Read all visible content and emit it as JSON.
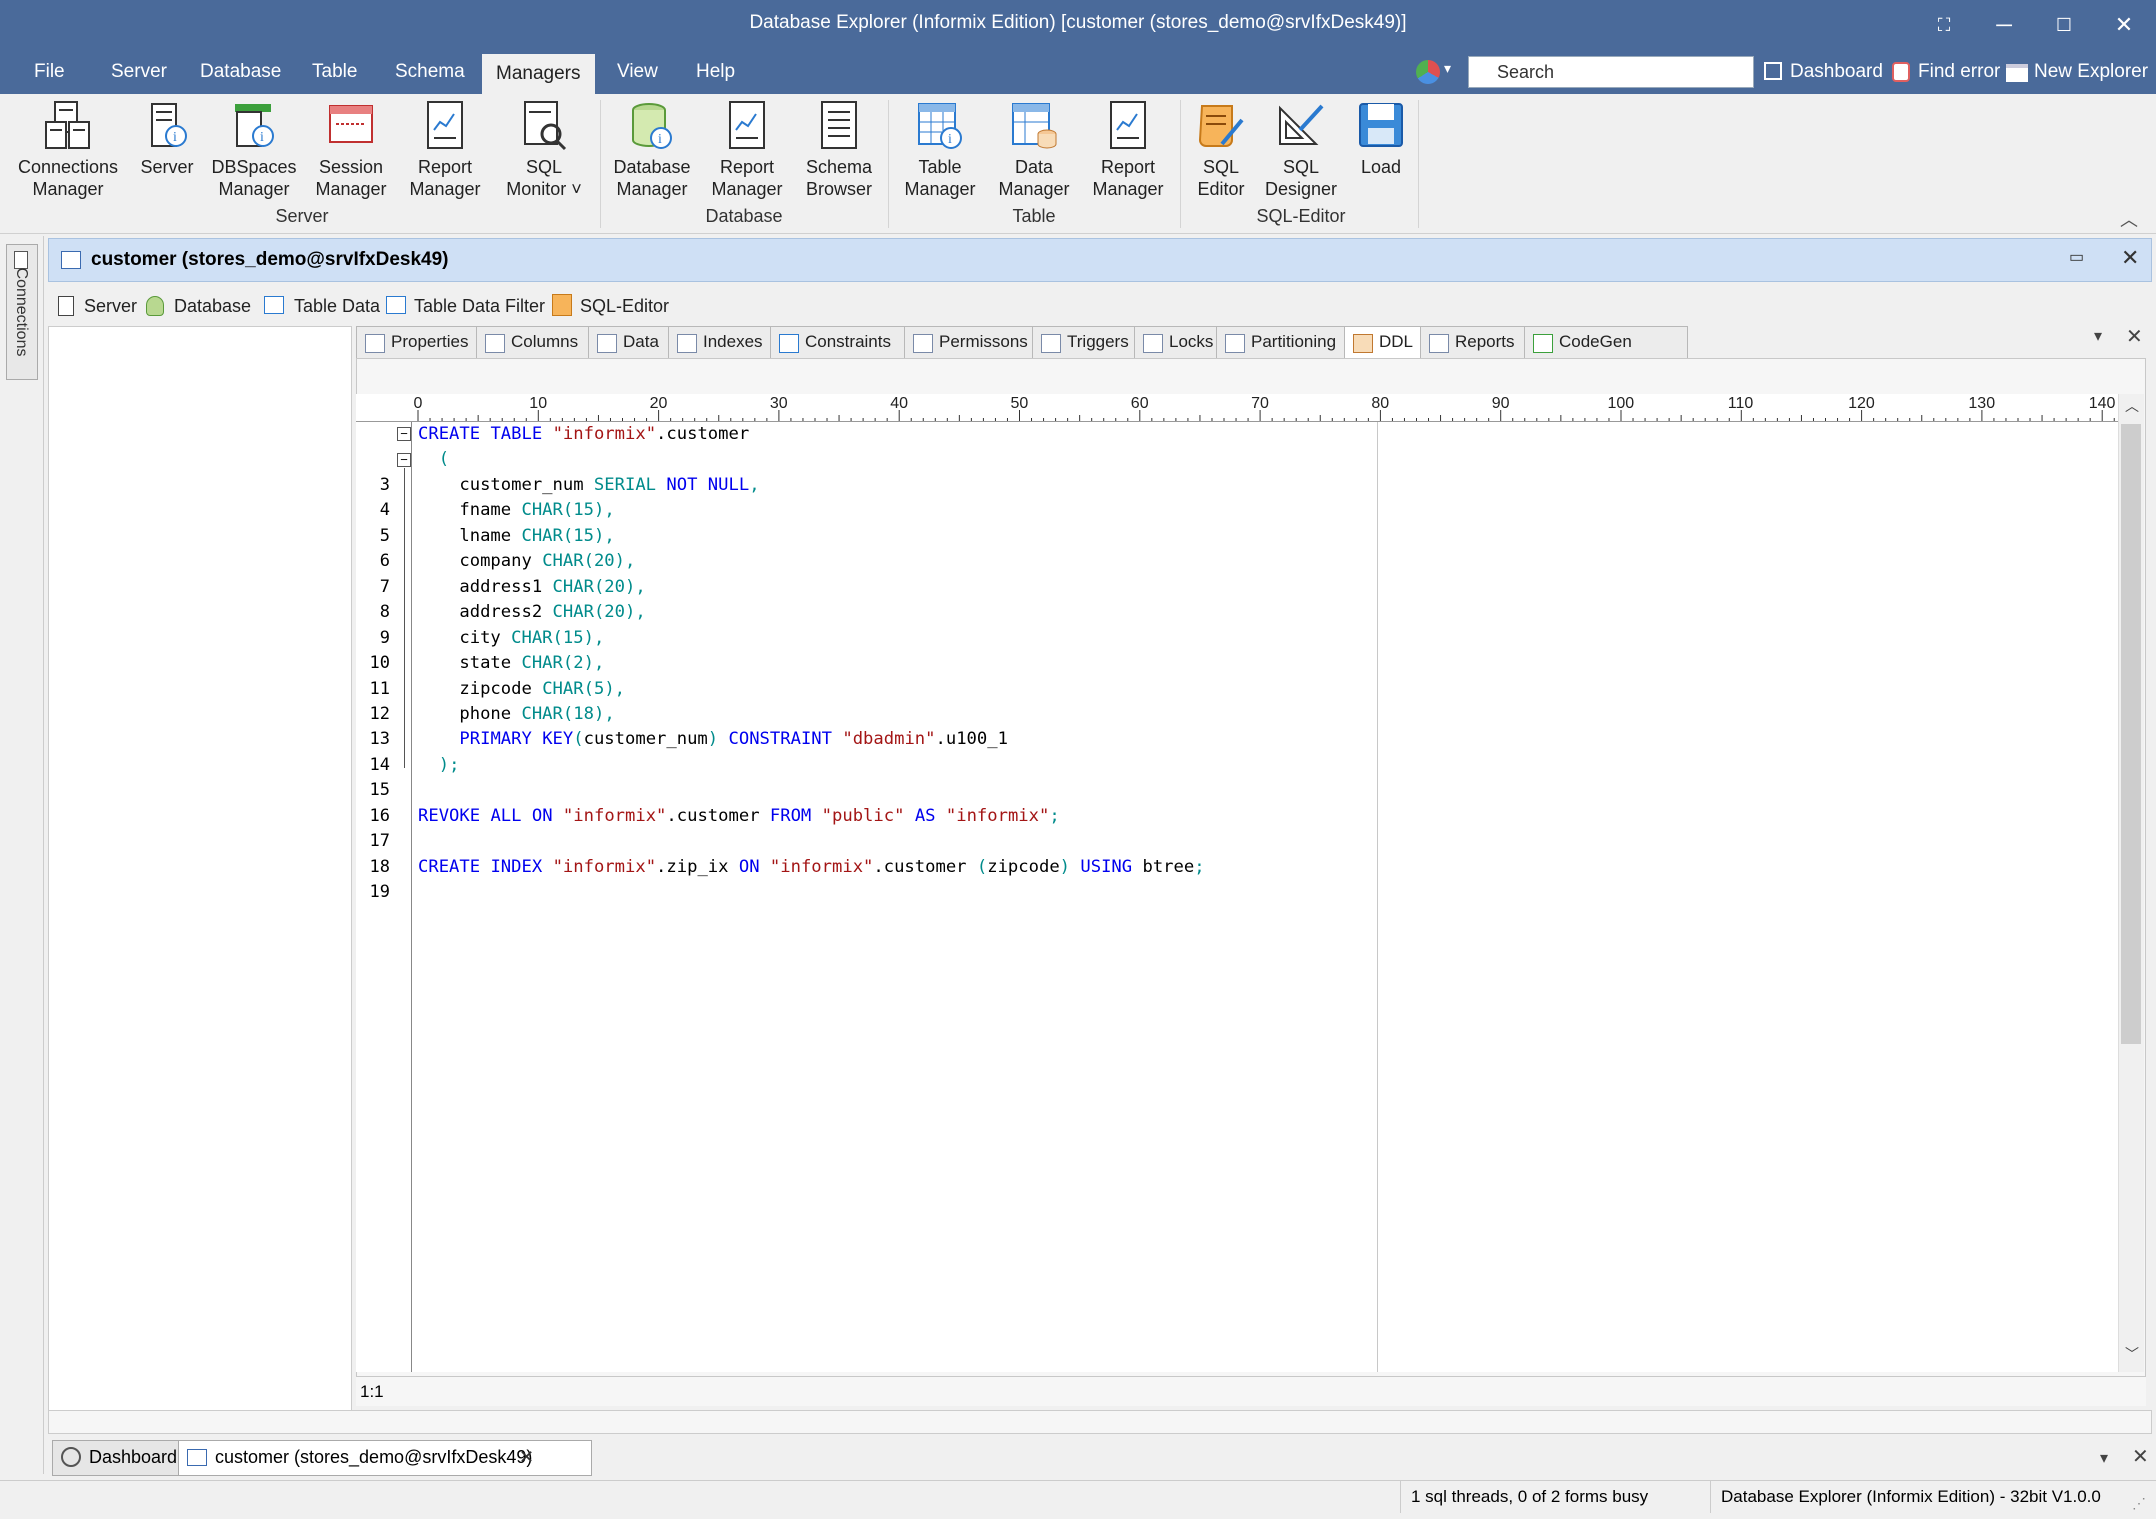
{
  "window": {
    "title": "Database Explorer (Informix Edition) [customer (stores_demo@srvIfxDesk49)]"
  },
  "menubar": {
    "items": [
      "File",
      "Server",
      "Database",
      "Table",
      "Schema",
      "Managers",
      "View",
      "Help"
    ],
    "active": "Managers",
    "search_placeholder": "Search",
    "right_links": [
      "Dashboard",
      "Find error",
      "New Explorer"
    ]
  },
  "ribbon": {
    "groups": [
      {
        "label": "Server",
        "buttons": [
          [
            "Connections",
            "Manager"
          ],
          [
            "Server"
          ],
          [
            "DBSpaces",
            "Manager"
          ],
          [
            "Session",
            "Manager"
          ],
          [
            "Report",
            "Manager"
          ],
          [
            "SQL",
            "Monitor ˅"
          ]
        ]
      },
      {
        "label": "Database",
        "buttons": [
          [
            "Database",
            "Manager"
          ],
          [
            "Report",
            "Manager"
          ],
          [
            "Schema",
            "Browser"
          ]
        ]
      },
      {
        "label": "Table",
        "buttons": [
          [
            "Table",
            "Manager"
          ],
          [
            "Data",
            "Manager"
          ],
          [
            "Report",
            "Manager"
          ]
        ]
      },
      {
        "label": "SQL-Editor",
        "buttons": [
          [
            "SQL",
            "Editor"
          ],
          [
            "SQL",
            "Designer"
          ],
          [
            "Load"
          ]
        ]
      }
    ]
  },
  "rail": {
    "label": "Connections"
  },
  "document": {
    "title": "customer (stores_demo@srvIfxDesk49)",
    "toolbar": [
      "Server",
      "Database",
      "Table Data",
      "Table Data Filter",
      "SQL-Editor"
    ],
    "tabs": [
      "Properties",
      "Columns",
      "Data",
      "Indexes",
      "Constraints",
      "Permissons",
      "Triggers",
      "Locks",
      "Partitioning",
      "DDL",
      "Reports",
      "CodeGen"
    ],
    "active_tab": "DDL"
  },
  "ruler": {
    "ticks": [
      "0",
      "10",
      "20",
      "30",
      "40",
      "50",
      "60",
      "70",
      "80",
      "90",
      "100",
      "110",
      "120",
      "130",
      "140"
    ]
  },
  "editor": {
    "line_numbers": [
      "",
      "",
      "3",
      "4",
      "5",
      "6",
      "7",
      "8",
      "9",
      "10",
      "11",
      "12",
      "13",
      "14",
      "15",
      "16",
      "17",
      "18",
      "19"
    ],
    "lines": [
      "CREATE TABLE \"informix\".customer",
      "  (",
      "    customer_num SERIAL NOT NULL,",
      "    fname CHAR(15),",
      "    lname CHAR(15),",
      "    company CHAR(20),",
      "    address1 CHAR(20),",
      "    address2 CHAR(20),",
      "    city CHAR(15),",
      "    state CHAR(2),",
      "    zipcode CHAR(5),",
      "    phone CHAR(18),",
      "    PRIMARY KEY(customer_num) CONSTRAINT \"dbadmin\".u100_1",
      "  );",
      "",
      "REVOKE ALL ON \"informix\".customer FROM \"public\" AS \"informix\";",
      "",
      "CREATE INDEX \"informix\".zip_ix ON \"informix\".customer (zipcode) USING btree;",
      ""
    ],
    "cursor_position": "1:1"
  },
  "bottom_tabs": [
    "Dashboard",
    "customer (stores_demo@srvIfxDesk49)"
  ],
  "statusbar": {
    "threads": "1 sql threads, 0 of 2 forms busy",
    "app": "Database Explorer (Informix Edition) - 32bit V1.0.0"
  },
  "colors": {
    "titlebar": "#4a6a9a",
    "docbar": "#cfe0f5",
    "keyword": "#0000ee",
    "type": "#008b8b",
    "string": "#a31515"
  }
}
